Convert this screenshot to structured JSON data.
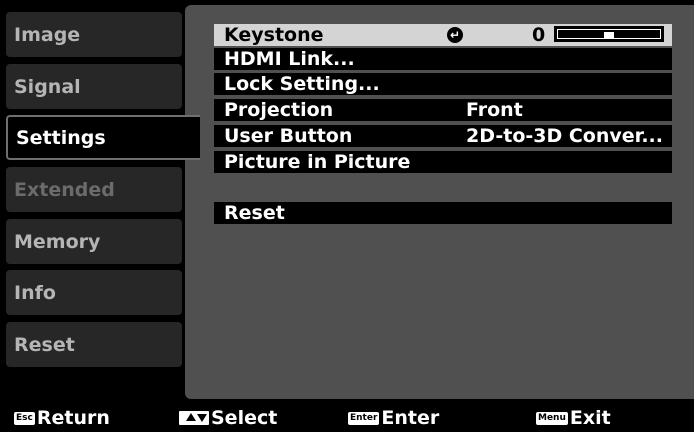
{
  "nav": {
    "items": [
      {
        "label": "Image"
      },
      {
        "label": "Signal"
      },
      {
        "label": "Settings",
        "selected": true
      },
      {
        "label": "Extended"
      },
      {
        "label": "Memory"
      },
      {
        "label": "Info"
      },
      {
        "label": "Reset"
      }
    ]
  },
  "settings": {
    "keystone": {
      "label": "Keystone",
      "value": "0",
      "enter_icon": "enter-arrow-icon",
      "slider_level_fraction": 0.5
    },
    "hdmi_link": {
      "label": "HDMI Link..."
    },
    "lock_setting": {
      "label": "Lock Setting..."
    },
    "projection": {
      "label": "Projection",
      "value": "Front"
    },
    "user_button": {
      "label": "User Button",
      "value": "2D-to-3D Conver..."
    },
    "picture_in_picture": {
      "label": "Picture in Picture"
    },
    "reset": {
      "label": "Reset"
    }
  },
  "footer": {
    "return": {
      "key": "Esc",
      "label": "Return"
    },
    "select": {
      "key": "arrow-keys-icon",
      "label": "Select"
    },
    "enter": {
      "key": "Enter",
      "label": "Enter"
    },
    "exit": {
      "key": "Menu",
      "label": "Exit"
    }
  },
  "colors": {
    "background": "#000000",
    "panel": "#505050",
    "nav_item": "#272727",
    "selected_row": "#d4d4d4"
  }
}
